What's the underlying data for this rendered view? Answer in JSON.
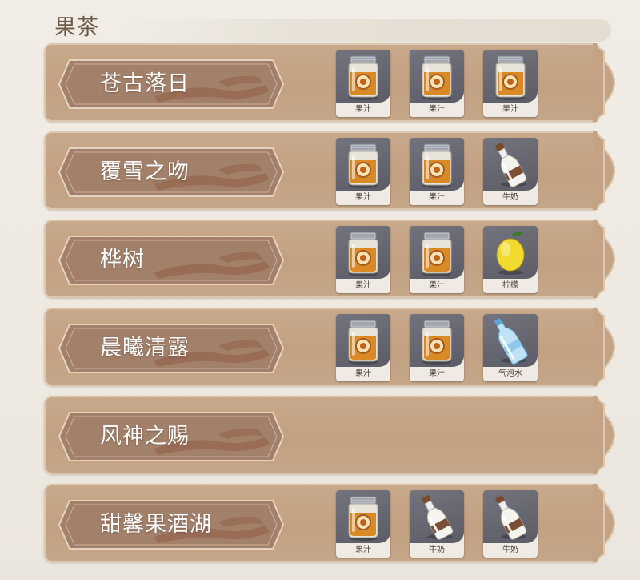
{
  "section": {
    "title": "果茶"
  },
  "recipes": [
    {
      "name": "苍古落日",
      "ingredients": [
        {
          "icon": "juice-jar-icon",
          "label": "果汁"
        },
        {
          "icon": "juice-jar-icon",
          "label": "果汁"
        },
        {
          "icon": "juice-jar-icon",
          "label": "果汁"
        }
      ]
    },
    {
      "name": "覆雪之吻",
      "ingredients": [
        {
          "icon": "juice-jar-icon",
          "label": "果汁"
        },
        {
          "icon": "juice-jar-icon",
          "label": "果汁"
        },
        {
          "icon": "milk-bottle-icon",
          "label": "牛奶"
        }
      ]
    },
    {
      "name": "桦树",
      "ingredients": [
        {
          "icon": "juice-jar-icon",
          "label": "果汁"
        },
        {
          "icon": "juice-jar-icon",
          "label": "果汁"
        },
        {
          "icon": "lemon-icon",
          "label": "柠檬"
        }
      ]
    },
    {
      "name": "晨曦清露",
      "ingredients": [
        {
          "icon": "juice-jar-icon",
          "label": "果汁"
        },
        {
          "icon": "juice-jar-icon",
          "label": "果汁"
        },
        {
          "icon": "sparkling-water-icon",
          "label": "气泡水"
        }
      ]
    },
    {
      "name": "风神之赐",
      "ingredients": []
    },
    {
      "name": "甜馨果酒湖",
      "ingredients": [
        {
          "icon": "juice-jar-icon",
          "label": "果汁"
        },
        {
          "icon": "milk-bottle-icon",
          "label": "牛奶"
        },
        {
          "icon": "milk-bottle-icon",
          "label": "牛奶"
        }
      ]
    }
  ],
  "colors": {
    "row_bg": "#c4a385",
    "banner_bg": "#a2806a",
    "banner_border": "#e8d6c2",
    "label_text": "#ffffff"
  }
}
